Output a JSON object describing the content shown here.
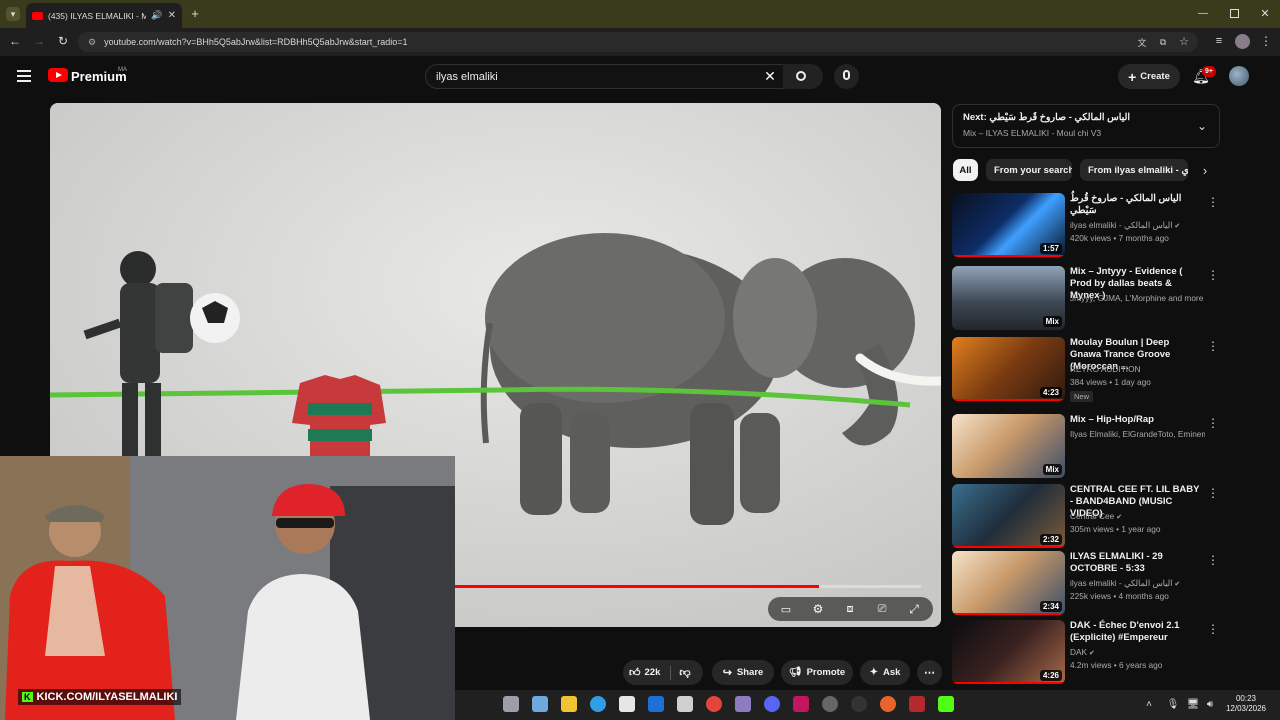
{
  "browser": {
    "tab_title": "(435) ILYAS ELMALIKI - Mou",
    "url": "youtube.com/watch?v=BHh5Q5abJrw&list=RDBHh5Q5abJrw&start_radio=1"
  },
  "header": {
    "logo": "Premium",
    "region": "MA",
    "search_value": "ilyas elmaliki",
    "create_label": "Create",
    "notif_count": "9+"
  },
  "player": {
    "watermark": "KICK.COM/ILYASELMALIKI",
    "progress": 0.88
  },
  "queue": {
    "next_prefix": "Next:",
    "next_title": "الياس المالكي - صاروخ قُرطُ سَيْطي",
    "mix_line": "Mix – ILYAS ELMALIKI - Moul chi V3"
  },
  "chips": [
    "All",
    "From your search",
    "From ilyas elmaliki - ي"
  ],
  "recommendations": [
    {
      "title": "الياس المالكي - صاروخ قُرطُ سَيْطي",
      "channel": "ilyas elmaliki - الياس المالكي",
      "verified": true,
      "stats": "420k views • 7 months ago",
      "badge": "1:57",
      "new": false
    },
    {
      "title": "Mix – Jntyyy - Evidence ( Prod by dallas beats & Mynex )",
      "channel": "Jntyyy, GJMA, L'Morphine and more",
      "verified": false,
      "stats": "",
      "badge": "Mix",
      "new": false
    },
    {
      "title": "Moulay Boulun | Deep Gnawa Trance Groove (Moroccan ...",
      "channel": "RETRO AUDITION",
      "verified": false,
      "stats": "384 views • 1 day ago",
      "badge": "4:23",
      "new": true
    },
    {
      "title": "Mix – Hip-Hop/Rap",
      "channel": "Ilyas Elmaliki, ElGrandeToto, Eminem an...",
      "verified": false,
      "stats": "",
      "badge": "Mix",
      "new": false
    },
    {
      "title": "CENTRAL CEE FT. LIL BABY - BAND4BAND (MUSIC VIDEO)",
      "channel": "Central Cee",
      "verified": true,
      "stats": "305m views • 1 year ago",
      "badge": "2:32",
      "new": false
    },
    {
      "title": "ILYAS ELMALIKI - 29 OCTOBRE - 5:33",
      "channel": "ilyas elmaliki - الياس المالكي",
      "verified": true,
      "stats": "225k views • 4 months ago",
      "badge": "2:34",
      "new": false
    },
    {
      "title": "DAK - Échec D'envoi 2.1 (Explicite) #Empereur",
      "channel": "DAK",
      "verified": true,
      "stats": "4.2m views • 6 years ago",
      "badge": "4:26",
      "new": false
    }
  ],
  "new_label": "New",
  "actions": {
    "likes": "22k",
    "share": "Share",
    "promote": "Promote",
    "ask": "Ask"
  },
  "taskbar": {
    "time": "00:23",
    "date": "12/03/2026"
  }
}
